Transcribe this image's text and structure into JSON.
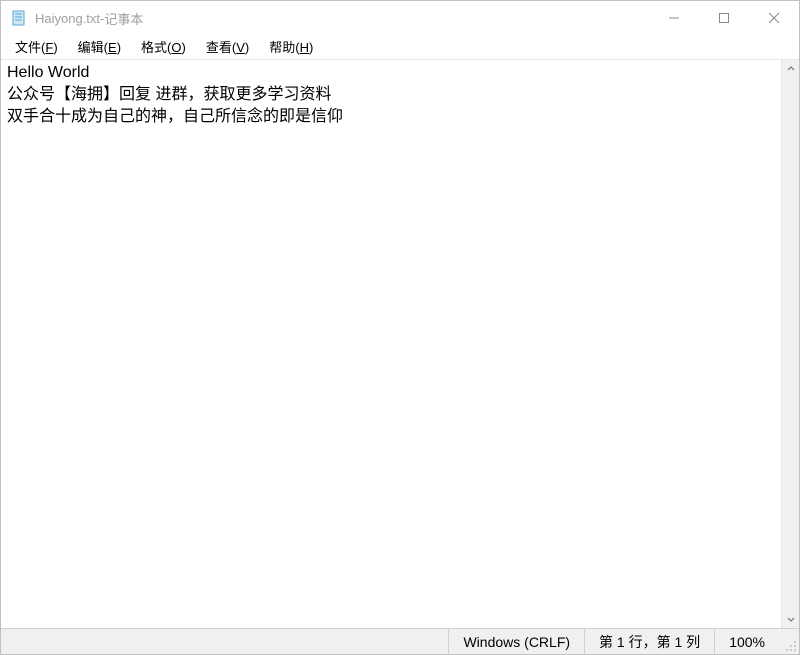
{
  "title": {
    "filename": "Haiyong.txt",
    "sep": " - ",
    "appname": "记事本"
  },
  "menu": {
    "file": {
      "label": "文件",
      "hotkey": "F"
    },
    "edit": {
      "label": "编辑",
      "hotkey": "E"
    },
    "format": {
      "label": "格式",
      "hotkey": "O"
    },
    "view": {
      "label": "查看",
      "hotkey": "V"
    },
    "help": {
      "label": "帮助",
      "hotkey": "H"
    }
  },
  "content": {
    "line1": "Hello World",
    "line2": "公众号【海拥】回复 进群，获取更多学习资料",
    "line3": "双手合十成为自己的神，自己所信念的即是信仰"
  },
  "status": {
    "encoding": "Windows (CRLF)",
    "position": "第 1 行，第 1 列",
    "zoom": "100%"
  }
}
